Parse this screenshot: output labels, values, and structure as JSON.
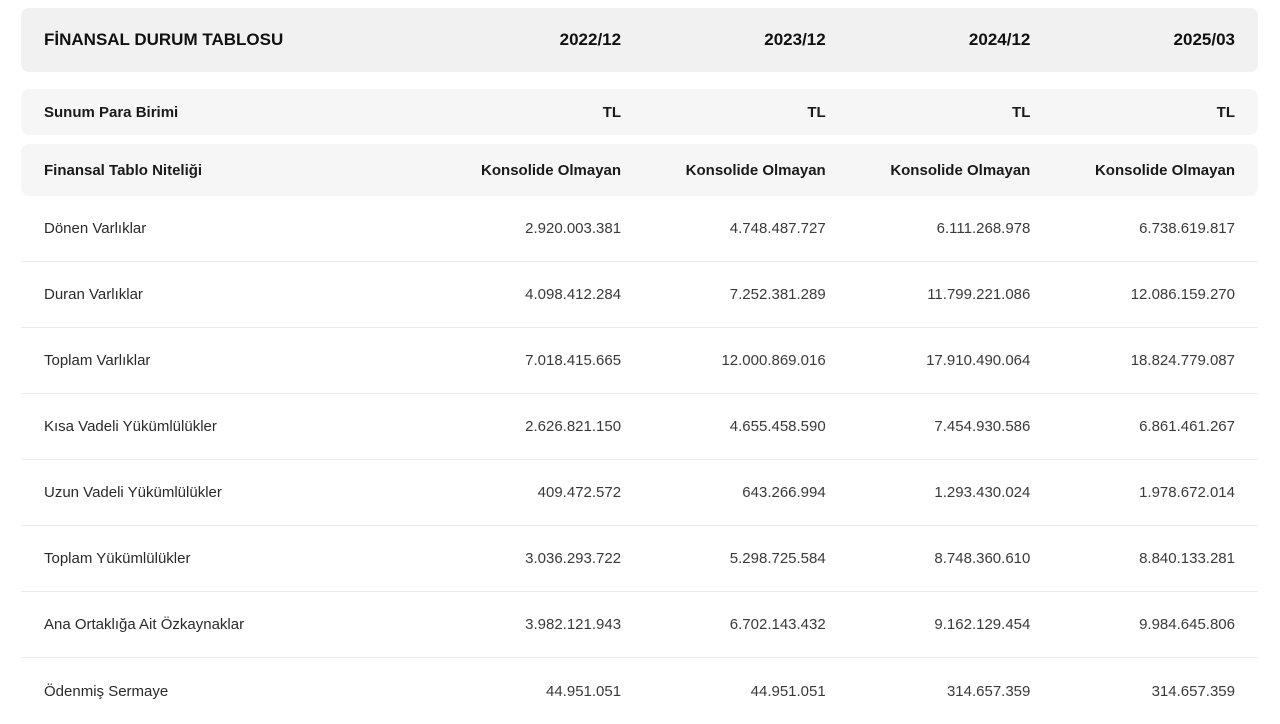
{
  "table": {
    "header": [
      "FİNANSAL DURUM TABLOSU",
      "2022/12",
      "2023/12",
      "2024/12",
      "2025/03"
    ],
    "meta_rows": [
      {
        "label": "Sunum Para Birimi",
        "values": [
          "TL",
          "TL",
          "TL",
          "TL"
        ]
      },
      {
        "label": "Finansal Tablo Niteliği",
        "values": [
          "Konsolide Olmayan",
          "Konsolide Olmayan",
          "Konsolide Olmayan",
          "Konsolide Olmayan"
        ]
      }
    ],
    "rows": [
      {
        "label": "Dönen Varlıklar",
        "values": [
          "2.920.003.381",
          "4.748.487.727",
          "6.111.268.978",
          "6.738.619.817"
        ]
      },
      {
        "label": "Duran Varlıklar",
        "values": [
          "4.098.412.284",
          "7.252.381.289",
          "11.799.221.086",
          "12.086.159.270"
        ]
      },
      {
        "label": "Toplam Varlıklar",
        "values": [
          "7.018.415.665",
          "12.000.869.016",
          "17.910.490.064",
          "18.824.779.087"
        ]
      },
      {
        "label": "Kısa Vadeli Yükümlülükler",
        "values": [
          "2.626.821.150",
          "4.655.458.590",
          "7.454.930.586",
          "6.861.461.267"
        ]
      },
      {
        "label": "Uzun Vadeli Yükümlülükler",
        "values": [
          "409.472.572",
          "643.266.994",
          "1.293.430.024",
          "1.978.672.014"
        ]
      },
      {
        "label": "Toplam Yükümlülükler",
        "values": [
          "3.036.293.722",
          "5.298.725.584",
          "8.748.360.610",
          "8.840.133.281"
        ]
      },
      {
        "label": "Ana Ortaklığa Ait Özkaynaklar",
        "values": [
          "3.982.121.943",
          "6.702.143.432",
          "9.162.129.454",
          "9.984.645.806"
        ]
      },
      {
        "label": "Ödenmiş Sermaye",
        "values": [
          "44.951.051",
          "44.951.051",
          "314.657.359",
          "314.657.359"
        ]
      }
    ]
  }
}
